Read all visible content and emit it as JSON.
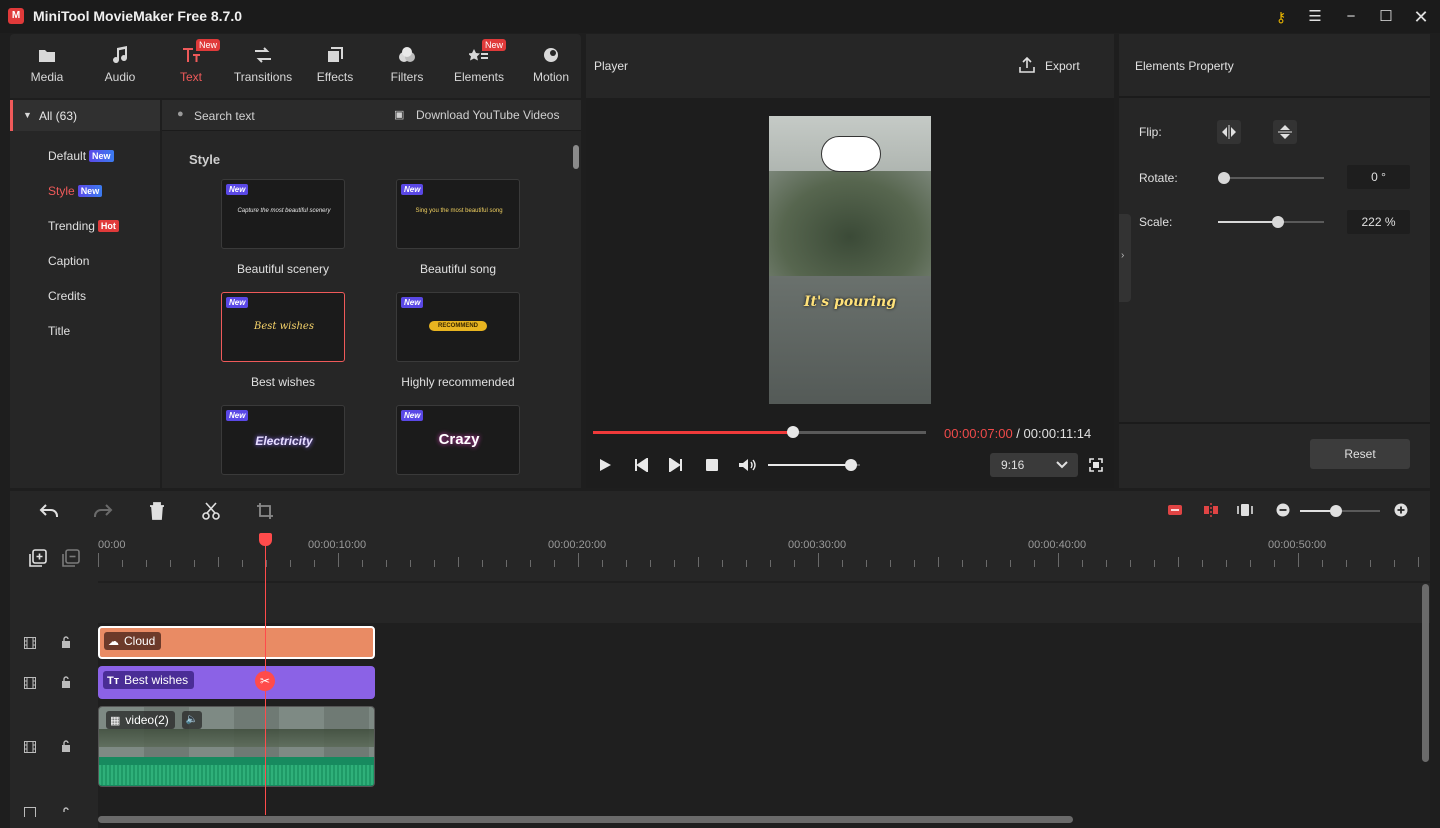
{
  "app": {
    "title": "MiniTool MovieMaker Free 8.7.0",
    "logo": "M"
  },
  "tabs": [
    {
      "label": "Media",
      "icon": "media-icon",
      "badge": ""
    },
    {
      "label": "Audio",
      "icon": "audio-icon",
      "badge": ""
    },
    {
      "label": "Text",
      "icon": "text-icon",
      "badge": "New"
    },
    {
      "label": "Transitions",
      "icon": "transitions-icon",
      "badge": ""
    },
    {
      "label": "Effects",
      "icon": "effects-icon",
      "badge": ""
    },
    {
      "label": "Filters",
      "icon": "filters-icon",
      "badge": ""
    },
    {
      "label": "Elements",
      "icon": "elements-icon",
      "badge": "New"
    },
    {
      "label": "Motion",
      "icon": "motion-icon",
      "badge": ""
    }
  ],
  "categories": {
    "all": "All (63)",
    "items": [
      {
        "label": "Default",
        "badge": "New"
      },
      {
        "label": "Style",
        "badge": "New"
      },
      {
        "label": "Trending",
        "badge": "Hot"
      },
      {
        "label": "Caption",
        "badge": ""
      },
      {
        "label": "Credits",
        "badge": ""
      },
      {
        "label": "Title",
        "badge": ""
      }
    ]
  },
  "text_panel": {
    "search_placeholder": "Search text",
    "download_link": "Download YouTube Videos",
    "section_title": "Style",
    "cards": [
      {
        "label": "Beautiful scenery",
        "badge": "New",
        "preview": "Capture the most beautiful scenery"
      },
      {
        "label": "Beautiful song",
        "badge": "New",
        "preview": "Sing you the most beautiful song"
      },
      {
        "label": "Best wishes",
        "badge": "New",
        "preview": "Best wishes"
      },
      {
        "label": "Highly recommended",
        "badge": "New",
        "preview": "RECOMMEND"
      },
      {
        "label": "",
        "badge": "New",
        "preview": "Electricity"
      },
      {
        "label": "",
        "badge": "New",
        "preview": "Crazy"
      }
    ]
  },
  "player": {
    "title": "Player",
    "export_label": "Export",
    "overlay_text": "It's pouring",
    "current_time": "00:00:07:00",
    "separator": " / ",
    "total_time": "00:00:11:14",
    "progress": 0.6,
    "volume": 0.9,
    "aspect_ratio": "9:16"
  },
  "properties": {
    "title": "Elements Property",
    "flip_label": "Flip:",
    "rotate_label": "Rotate:",
    "rotate_value": "0 °",
    "rotate_level": 0,
    "scale_label": "Scale:",
    "scale_value": "222 %",
    "scale_level": 0.57,
    "reset_label": "Reset"
  },
  "timeline": {
    "time_labels": [
      "00:00",
      "00:00:10:00",
      "00:00:20:00",
      "00:00:30:00",
      "00:00:40:00",
      "00:00:50:00"
    ],
    "zoom_level": 0.45,
    "clips": {
      "cloud": "Cloud",
      "text": "Best wishes",
      "video": "video(2)"
    }
  },
  "colors": {
    "accent": "#ef5a5a",
    "cloud_clip": "#e98b64",
    "text_clip": "#8b62e6",
    "waveform": "#2fb07a"
  }
}
